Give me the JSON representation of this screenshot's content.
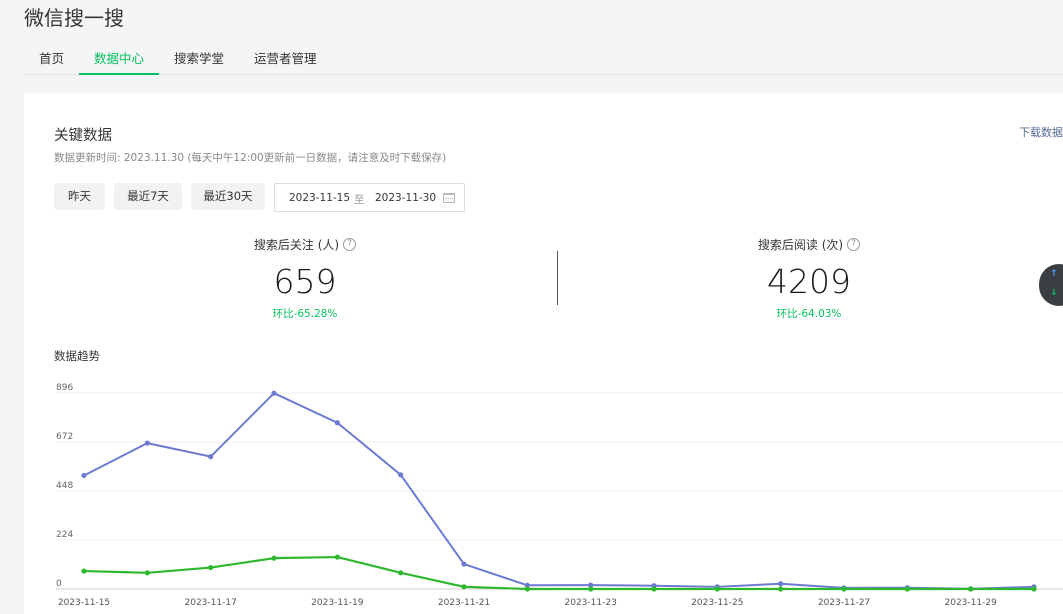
{
  "app": {
    "title": "微信搜一搜"
  },
  "tabs": [
    {
      "label": "首页"
    },
    {
      "label": "数据中心",
      "active": true
    },
    {
      "label": "搜索学堂"
    },
    {
      "label": "运营者管理"
    }
  ],
  "key_data": {
    "title": "关键数据",
    "download_label": "下载数据",
    "update_note": "数据更新时间: 2023.11.30 (每天中午12:00更新前一日数据，请注意及时下载保存)",
    "range_buttons": [
      "昨天",
      "最近7天",
      "最近30天"
    ],
    "date_start": "2023-11-15",
    "date_sep": "至",
    "date_end": "2023-11-30"
  },
  "metrics": [
    {
      "label": "搜索后关注 (人)",
      "value": "659",
      "delta": "环比-65.28%"
    },
    {
      "label": "搜索后阅读 (次)",
      "value": "4209",
      "delta": "环比-64.03%"
    }
  ],
  "help_glyph": "?",
  "trend": {
    "title": "数据趋势"
  },
  "widget": {
    "up": "↑",
    "down": "↓"
  },
  "colors": {
    "accent": "#07c160",
    "series_read": "#6c7bd1",
    "series_follow": "#2eb82e"
  },
  "chart_data": {
    "type": "line",
    "x": [
      "2023-11-15",
      "2023-11-16",
      "2023-11-17",
      "2023-11-18",
      "2023-11-19",
      "2023-11-20",
      "2023-11-21",
      "2023-11-22",
      "2023-11-23",
      "2023-11-24",
      "2023-11-25",
      "2023-11-26",
      "2023-11-27",
      "2023-11-28",
      "2023-11-29",
      "2023-11-30"
    ],
    "xtick_labels": [
      "2023-11-15",
      "2023-11-17",
      "2023-11-19",
      "2023-11-21",
      "2023-11-23",
      "2023-11-25",
      "2023-11-27",
      "2023-11-29"
    ],
    "yticks": [
      0,
      224,
      448,
      672,
      896
    ],
    "ylim": [
      0,
      896
    ],
    "grid": true,
    "series": [
      {
        "values": [
          519,
          667,
          605,
          895,
          760,
          522,
          114,
          17,
          18,
          15,
          10,
          24,
          5,
          6,
          1,
          10
        ],
        "color": "#6c7bd1"
      },
      {
        "values": [
          82,
          74,
          98,
          141,
          146,
          74,
          10,
          0,
          0,
          0,
          0,
          0,
          0,
          0,
          0,
          0
        ],
        "color": "#2eb82e"
      }
    ]
  }
}
